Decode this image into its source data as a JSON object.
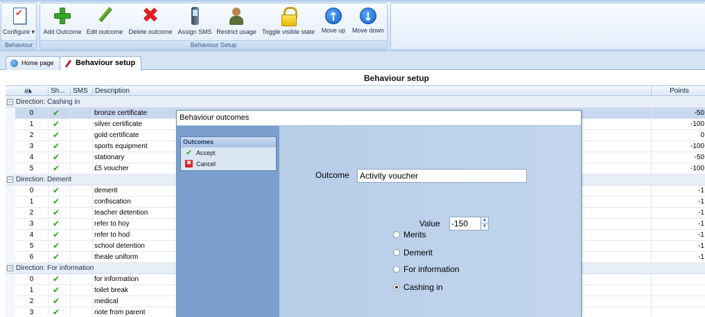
{
  "ribbon": {
    "groups": {
      "behaviour": "Behaviour",
      "setup": "Behaviour Setup"
    },
    "buttons": {
      "configure": "Configure",
      "add_outcome": "Add Outcome",
      "edit_outcome": "Edit outcome",
      "delete_outcome": "Delete outcome",
      "assign_sms": "Assign SMS",
      "restrict_usage": "Restrict usage",
      "toggle_visible": "Toggle visible state",
      "move_up": "Move up",
      "move_down": "Move down"
    }
  },
  "tabs": {
    "home": "Home page",
    "setup": "Behaviour setup"
  },
  "page_title": "Behaviour setup",
  "grid": {
    "headers": {
      "num": "#",
      "shown": "Sh...",
      "sms": "SMS",
      "description": "Description",
      "points": "Points"
    },
    "groups": [
      {
        "label": "Direction: Cashing in",
        "rows": [
          {
            "num": "0",
            "shown": "✔",
            "desc": "bronze certificate",
            "points": "-50"
          },
          {
            "num": "1",
            "shown": "✔",
            "desc": "silver certificate",
            "points": "-100"
          },
          {
            "num": "2",
            "shown": "✔",
            "desc": "gold certificate",
            "points": "0"
          },
          {
            "num": "3",
            "shown": "✔",
            "desc": "sports equipment",
            "points": "-100"
          },
          {
            "num": "4",
            "shown": "✔",
            "desc": "stationary",
            "points": "-50"
          },
          {
            "num": "5",
            "shown": "✔",
            "desc": "£5 voucher",
            "points": "-100"
          }
        ]
      },
      {
        "label": "Direction: Demerit",
        "rows": [
          {
            "num": "0",
            "shown": "✔",
            "desc": "demerit",
            "points": "-1"
          },
          {
            "num": "1",
            "shown": "✔",
            "desc": "confiscation",
            "points": "-1"
          },
          {
            "num": "2",
            "shown": "✔",
            "desc": "teacher detention",
            "points": "-1"
          },
          {
            "num": "3",
            "shown": "✔",
            "desc": "refer to hoy",
            "points": "-1"
          },
          {
            "num": "4",
            "shown": "✔",
            "desc": "refer to hod",
            "points": "-1"
          },
          {
            "num": "5",
            "shown": "✔",
            "desc": "school detention",
            "points": "-1"
          },
          {
            "num": "6",
            "shown": "✔",
            "desc": "theale uniform",
            "points": "-1"
          }
        ]
      },
      {
        "label": "Direction: For information",
        "rows": [
          {
            "num": "0",
            "shown": "✔",
            "desc": "for information",
            "points": ""
          },
          {
            "num": "1",
            "shown": "✔",
            "desc": "toilet break",
            "points": ""
          },
          {
            "num": "2",
            "shown": "✔",
            "desc": "medical",
            "points": ""
          },
          {
            "num": "3",
            "shown": "✔",
            "desc": "note from parent",
            "points": ""
          }
        ]
      }
    ]
  },
  "dialog": {
    "title": "Behaviour outcomes",
    "nav": {
      "header": "Outcomes",
      "accept": "Accept",
      "cancel": "Cancel"
    },
    "outcome_label": "Outcome",
    "outcome_value": "Activity voucher",
    "value_label": "Value",
    "value": "-150",
    "options": [
      "Merits",
      "Demerit",
      "For information",
      "Cashing in"
    ],
    "selected_option": "Cashing in"
  }
}
